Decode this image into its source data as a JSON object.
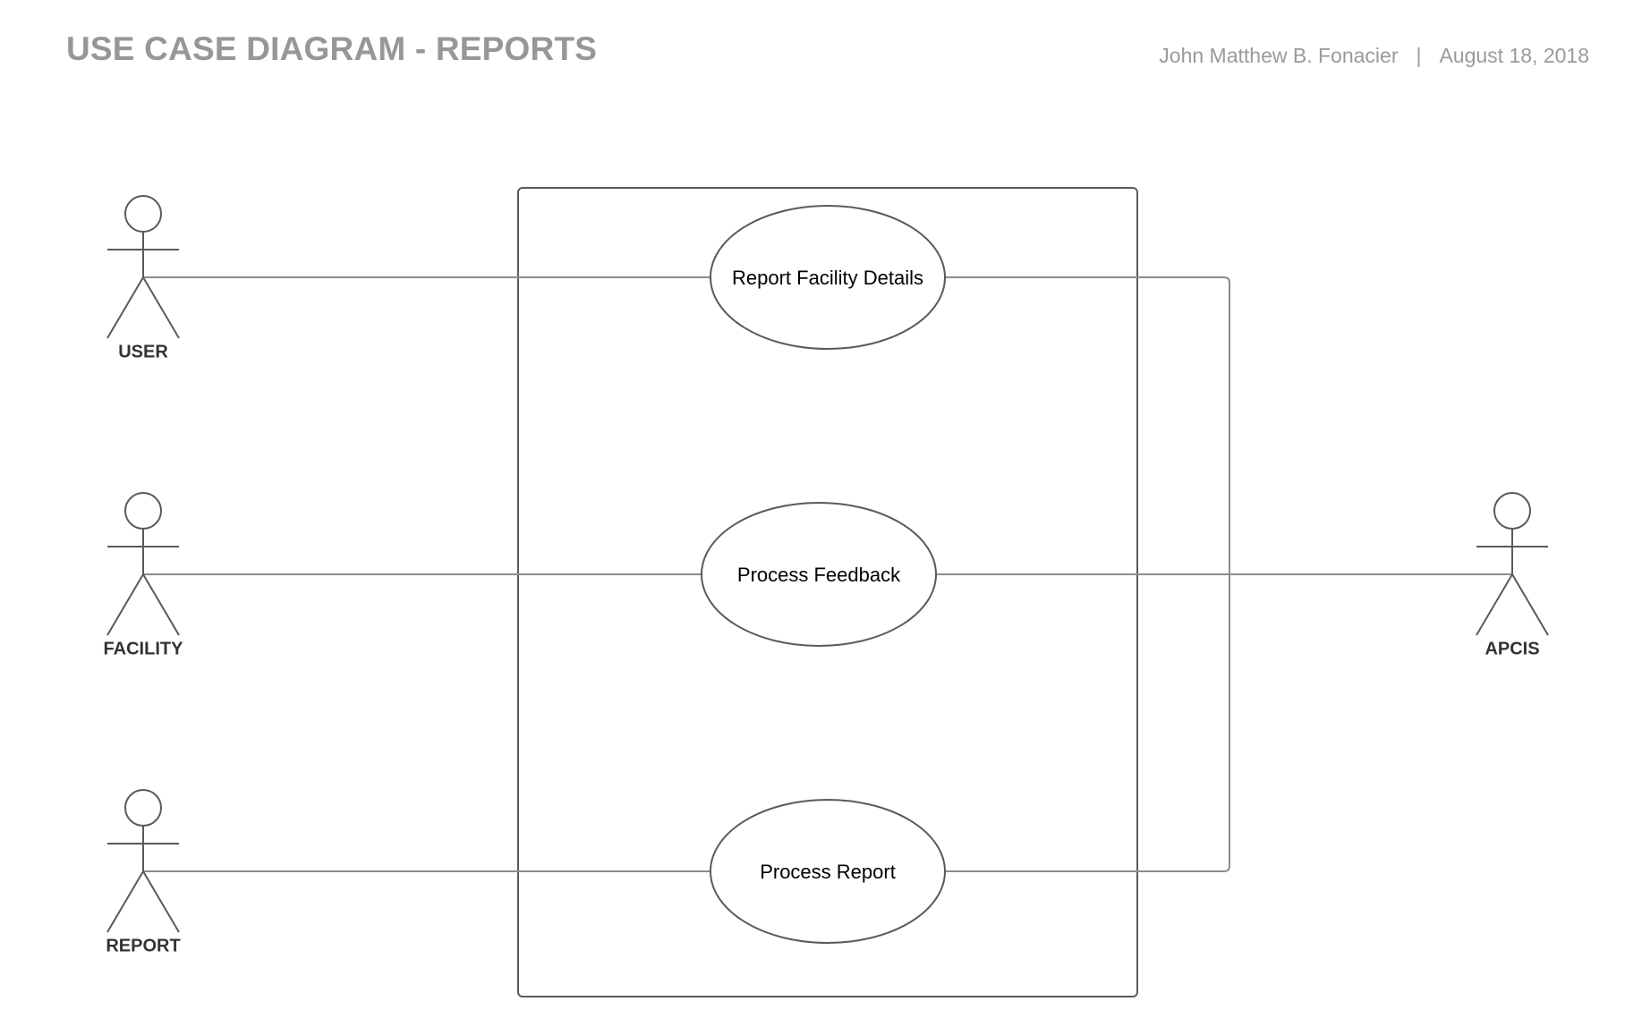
{
  "header": {
    "title": "USE CASE DIAGRAM - REPORTS",
    "author": "John Matthew B. Fonacier",
    "separator": "|",
    "date": "August 18, 2018"
  },
  "actors": {
    "user": "USER",
    "facility": "FACILITY",
    "report": "REPORT",
    "apcis": "APCIS"
  },
  "use_cases": {
    "report_facility_details": "Report Facility Details",
    "process_feedback": "Process Feedback",
    "process_report": "Process Report"
  },
  "colors": {
    "stroke": "#5a5a5a",
    "connector": "#8c8c8c",
    "title": "#979797"
  }
}
